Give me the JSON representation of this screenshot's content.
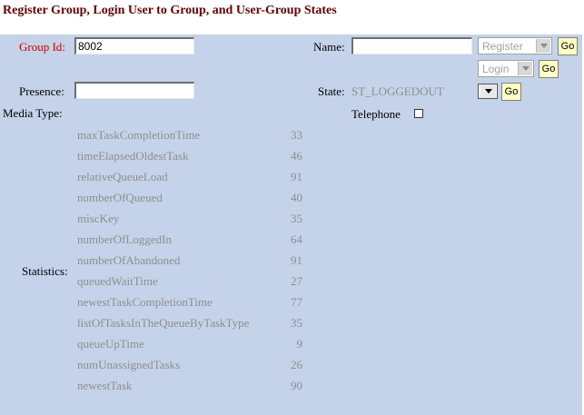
{
  "title": "Register Group, Login User to Group, and User-Group States",
  "form": {
    "group_id_label": "Group Id:",
    "group_id_value": "8002",
    "name_label": "Name:",
    "name_value": "",
    "presence_label": "Presence:",
    "presence_value": "",
    "state_label": "State:",
    "state_value": "ST_LOGGEDOUT",
    "media_type_label": "Media Type:",
    "telephone_label": "Telephone",
    "telephone_checked": false,
    "register_select": "Register",
    "login_select": "Login",
    "go_label": "Go"
  },
  "statistics": {
    "label": "Statistics:",
    "items": [
      {
        "name": "maxTaskCompletionTime",
        "value": "33"
      },
      {
        "name": "timeElapsedOldestTask",
        "value": "46"
      },
      {
        "name": "relativeQueueLoad",
        "value": "91"
      },
      {
        "name": "numberOfQueued",
        "value": "40"
      },
      {
        "name": "miscKey",
        "value": "35"
      },
      {
        "name": "numberOfLoggedIn",
        "value": "64"
      },
      {
        "name": "numberOfAbandoned",
        "value": "91"
      },
      {
        "name": "queuedWaitTime",
        "value": "27"
      },
      {
        "name": "newestTaskCompletionTime",
        "value": "77"
      },
      {
        "name": "listOfTasksInTheQueueByTaskType",
        "value": "35"
      },
      {
        "name": "queueUpTime",
        "value": "9"
      },
      {
        "name": "numUnassignedTasks",
        "value": "26"
      },
      {
        "name": "newestTask",
        "value": "90"
      }
    ]
  }
}
